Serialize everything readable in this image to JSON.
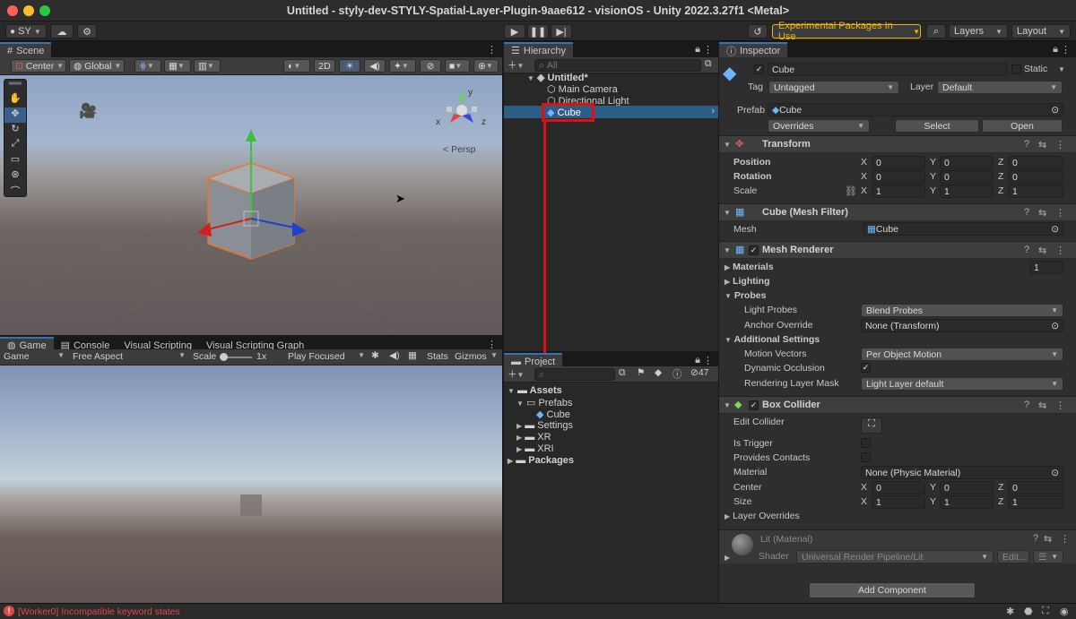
{
  "window": {
    "title": "Untitled - styly-dev-STYLY-Spatial-Layer-Plugin-9aae612 - visionOS - Unity 2022.3.27f1 <Metal>"
  },
  "toolbar": {
    "account": "SY",
    "experimental": "Experimental Packages In Use",
    "layers": "Layers",
    "layout": "Layout"
  },
  "scene": {
    "tab": "Scene",
    "pivot": "Center",
    "space": "Global",
    "mode2d": "2D",
    "persp": "Persp",
    "gizmo": {
      "y": "y",
      "x": "x",
      "z": "z"
    }
  },
  "game": {
    "tabs": [
      "Game",
      "Console",
      "Visual Scripting",
      "Visual Scripting Graph"
    ],
    "display": "Game",
    "aspect": "Free Aspect",
    "scale_label": "Scale",
    "scale_value": "1x",
    "play_mode": "Play Focused",
    "stats": "Stats",
    "gizmos": "Gizmos"
  },
  "hierarchy": {
    "tab": "Hierarchy",
    "search_placeholder": "All",
    "scene": "Untitled*",
    "items": [
      "Main Camera",
      "Directional Light",
      "Cube"
    ]
  },
  "project": {
    "tab": "Project",
    "count": "47",
    "tree": [
      "Assets",
      "Prefabs",
      "Cube",
      "Settings",
      "XR",
      "XRI",
      "Packages"
    ]
  },
  "inspector": {
    "tab": "Inspector",
    "object_name": "Cube",
    "static_label": "Static",
    "tag_label": "Tag",
    "tag_value": "Untagged",
    "layer_label": "Layer",
    "layer_value": "Default",
    "prefab_label": "Prefab",
    "prefab_value": "Cube",
    "overrides": "Overrides",
    "select": "Select",
    "open": "Open",
    "transform": {
      "title": "Transform",
      "position": "Position",
      "rotation": "Rotation",
      "scale": "Scale",
      "pos": [
        "0",
        "0",
        "0"
      ],
      "rot": [
        "0",
        "0",
        "0"
      ],
      "scl": [
        "1",
        "1",
        "1"
      ]
    },
    "axes": [
      "X",
      "Y",
      "Z"
    ],
    "mesh_filter": {
      "title": "Cube (Mesh Filter)",
      "mesh_label": "Mesh",
      "mesh_value": "Cube"
    },
    "mesh_renderer": {
      "title": "Mesh Renderer",
      "materials": "Materials",
      "materials_count": "1",
      "lighting": "Lighting",
      "probes": "Probes",
      "light_probes": "Light Probes",
      "light_probes_value": "Blend Probes",
      "anchor_override": "Anchor Override",
      "anchor_value": "None (Transform)",
      "additional": "Additional Settings",
      "motion_vectors": "Motion Vectors",
      "motion_value": "Per Object Motion",
      "dynamic_occlusion": "Dynamic Occlusion",
      "rendering_mask": "Rendering Layer Mask",
      "rendering_value": "Light Layer default"
    },
    "box_collider": {
      "title": "Box Collider",
      "edit_collider": "Edit Collider",
      "is_trigger": "Is Trigger",
      "provides_contacts": "Provides Contacts",
      "material": "Material",
      "material_value": "None (Physic Material)",
      "center": "Center",
      "size": "Size",
      "center_vals": [
        "0",
        "0",
        "0"
      ],
      "size_vals": [
        "1",
        "1",
        "1"
      ],
      "layer_overrides": "Layer Overrides"
    },
    "material": {
      "name": "Lit (Material)",
      "shader_label": "Shader",
      "shader_value": "Universal Render Pipeline/Lit",
      "edit": "Edit..."
    },
    "add_component": "Add Component"
  },
  "status": {
    "message": "[Worker0] Incompatible keyword states"
  },
  "colors": {
    "accent": "#3a72b0",
    "selection": "#2c5d87",
    "highlight_box": "#e01010",
    "warning": "#f0b400",
    "error": "#e04848"
  }
}
